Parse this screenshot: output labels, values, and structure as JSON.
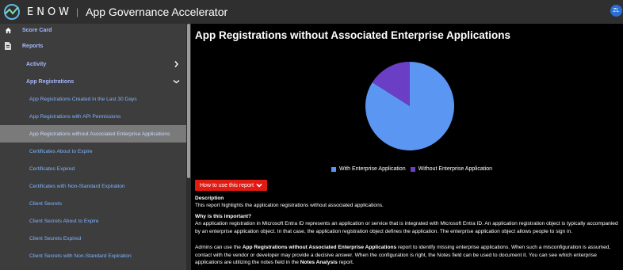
{
  "header": {
    "brand": "ENOW",
    "separator": "|",
    "app_title": "App Governance Accelerator",
    "avatar_initials": "ZL"
  },
  "sidebar": {
    "score_card": "Score Card",
    "reports": "Reports",
    "activity": "Activity",
    "app_registrations": "App Registrations",
    "items": [
      "App Registrations Created in the Last 30 Days",
      "App Registrations with API Permissions",
      "App Registrations without Associated Enterprise Applications",
      "Certificates About to Expire",
      "Certificates Expired",
      "Certificates with Non-Standard Expiration",
      "Client Secrets",
      "Client Secrets About to Expire",
      "Client Secrets Expired",
      "Client Secrets with Non-Standard Expiration"
    ],
    "active_index": 2
  },
  "main": {
    "title": "App Registrations without Associated Enterprise Applications",
    "howto_label": "How to use this report",
    "description_heading": "Description",
    "description_text": "This report highlights the application registrations without associated applications.",
    "why_heading": "Why is this important?",
    "why_text": "An application registration in Microsoft Entra ID represents an application or service that is integrated with Microsoft Entra ID. An application registration object is typically accompanied by an enterprise application object. In that case, the application registration object defines the application. The enterprise application object allows people to sign in.",
    "admins_prefix": "Admins can use the ",
    "admins_bold": "App Registrations without Associated Enterprise Applications",
    "admins_mid": " report to identify missing enterprise applications. When such a misconfiguration is assumed, contact with the vendor or developer may provide a decisive answer. When the configuration is right, the Notes field can be used to document it. You can see which enterprise applications are utilizing the notes field in the ",
    "admins_bold2": "Notes Analysis",
    "admins_suffix": " report."
  },
  "colors": {
    "with": "#5b96f3",
    "without": "#6a3fc6",
    "accent": "#e11a12"
  },
  "chart_data": {
    "type": "pie",
    "title": "",
    "categories": [
      "With Enterprise Application",
      "Without Enterprise Application"
    ],
    "values": [
      84,
      16
    ],
    "legend": "bottom"
  }
}
